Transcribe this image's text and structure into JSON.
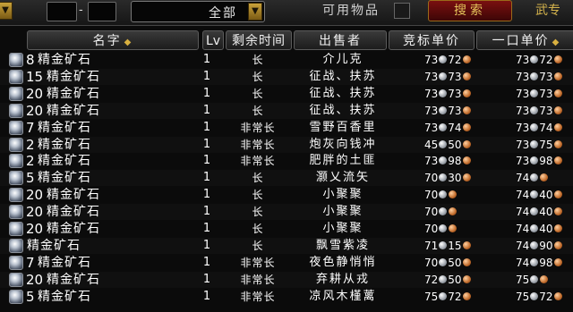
{
  "toolbar": {
    "dash": "-",
    "filter_value": "全部",
    "usable_label": "可用物品",
    "search_label": "搜索",
    "right_label": "武专"
  },
  "columns": {
    "name": "名字",
    "lv": "Lv",
    "time": "剩余时间",
    "seller": "出售者",
    "bid": "竞标单价",
    "buyout": "一口单价"
  },
  "rows": [
    {
      "qty": "8",
      "name": "精金矿石",
      "lv": "1",
      "time": "长",
      "seller": "介儿克",
      "bid_s": "73",
      "bid_c": "72",
      "buy_s": "73",
      "buy_c": "72"
    },
    {
      "qty": "15",
      "name": "精金矿石",
      "lv": "1",
      "time": "长",
      "seller": "征战、扶苏",
      "bid_s": "73",
      "bid_c": "73",
      "buy_s": "73",
      "buy_c": "73"
    },
    {
      "qty": "20",
      "name": "精金矿石",
      "lv": "1",
      "time": "长",
      "seller": "征战、扶苏",
      "bid_s": "73",
      "bid_c": "73",
      "buy_s": "73",
      "buy_c": "73"
    },
    {
      "qty": "20",
      "name": "精金矿石",
      "lv": "1",
      "time": "长",
      "seller": "征战、扶苏",
      "bid_s": "73",
      "bid_c": "73",
      "buy_s": "73",
      "buy_c": "73"
    },
    {
      "qty": "7",
      "name": "精金矿石",
      "lv": "1",
      "time": "非常长",
      "seller": "雪野百香里",
      "bid_s": "73",
      "bid_c": "74",
      "buy_s": "73",
      "buy_c": "74"
    },
    {
      "qty": "2",
      "name": "精金矿石",
      "lv": "1",
      "time": "非常长",
      "seller": "炮灰向钱冲",
      "bid_s": "45",
      "bid_c": "50",
      "buy_s": "73",
      "buy_c": "75"
    },
    {
      "qty": "2",
      "name": "精金矿石",
      "lv": "1",
      "time": "非常长",
      "seller": "肥胖的土匪",
      "bid_s": "73",
      "bid_c": "98",
      "buy_s": "73",
      "buy_c": "98"
    },
    {
      "qty": "5",
      "name": "精金矿石",
      "lv": "1",
      "time": "长",
      "seller": "灏乂流矢",
      "bid_s": "70",
      "bid_c": "30",
      "buy_s": "74",
      "buy_c": ""
    },
    {
      "qty": "20",
      "name": "精金矿石",
      "lv": "1",
      "time": "长",
      "seller": "小聚聚",
      "bid_s": "70",
      "bid_c": "",
      "buy_s": "74",
      "buy_c": "40"
    },
    {
      "qty": "20",
      "name": "精金矿石",
      "lv": "1",
      "time": "长",
      "seller": "小聚聚",
      "bid_s": "70",
      "bid_c": "",
      "buy_s": "74",
      "buy_c": "40"
    },
    {
      "qty": "20",
      "name": "精金矿石",
      "lv": "1",
      "time": "长",
      "seller": "小聚聚",
      "bid_s": "70",
      "bid_c": "",
      "buy_s": "74",
      "buy_c": "40"
    },
    {
      "qty": "",
      "name": "精金矿石",
      "lv": "1",
      "time": "长",
      "seller": "飘雪紫凌",
      "bid_s": "71",
      "bid_c": "15",
      "buy_s": "74",
      "buy_c": "90"
    },
    {
      "qty": "7",
      "name": "精金矿石",
      "lv": "1",
      "time": "非常长",
      "seller": "夜色静悄悄",
      "bid_s": "70",
      "bid_c": "50",
      "buy_s": "74",
      "buy_c": "98"
    },
    {
      "qty": "20",
      "name": "精金矿石",
      "lv": "1",
      "time": "非常长",
      "seller": "弃耕从戎",
      "bid_s": "72",
      "bid_c": "50",
      "buy_s": "75",
      "buy_c": ""
    },
    {
      "qty": "5",
      "name": "精金矿石",
      "lv": "1",
      "time": "非常长",
      "seller": "凉风木槿蓠",
      "bid_s": "75",
      "bid_c": "72",
      "buy_s": "75",
      "buy_c": "72"
    }
  ]
}
